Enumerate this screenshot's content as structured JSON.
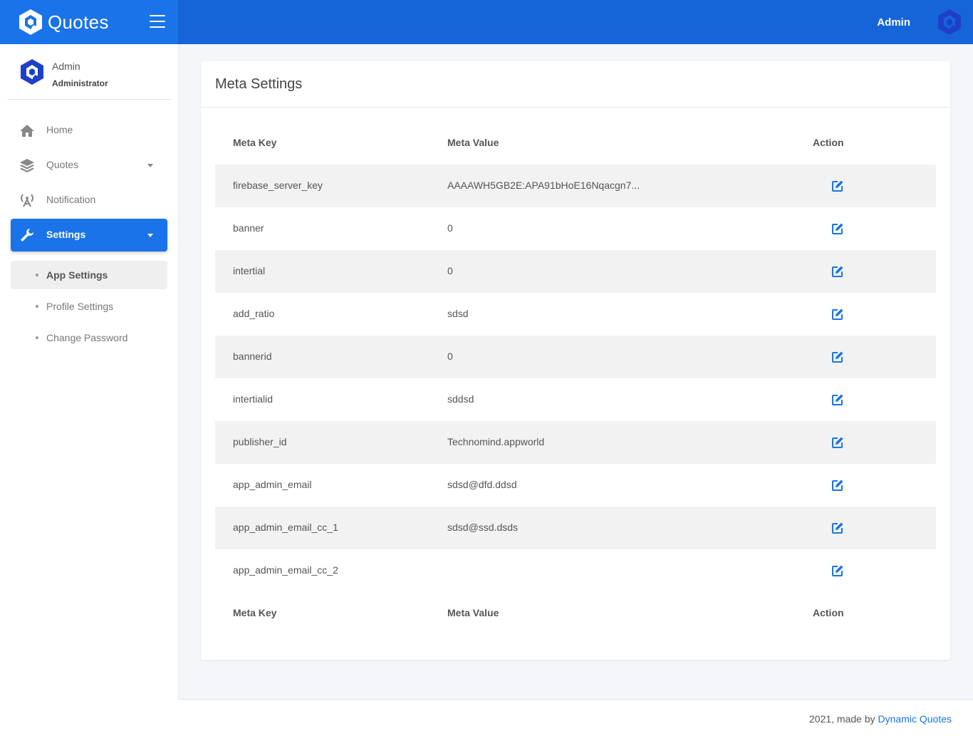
{
  "app": {
    "name": "Quotes",
    "accent": "#1a73e8"
  },
  "header": {
    "user_label": "Admin"
  },
  "user_panel": {
    "name": "Admin",
    "role": "Administrator"
  },
  "sidebar": {
    "items": [
      {
        "label": "Home",
        "icon": "home-icon"
      },
      {
        "label": "Quotes",
        "icon": "layers-icon"
      },
      {
        "label": "Notification",
        "icon": "broadcast-icon"
      },
      {
        "label": "Settings",
        "icon": "wrench-icon"
      }
    ],
    "sub_items": [
      {
        "label": "App Settings"
      },
      {
        "label": "Profile Settings"
      },
      {
        "label": "Change Password"
      }
    ]
  },
  "card": {
    "title": "Meta Settings"
  },
  "table": {
    "columns": [
      "Meta Key",
      "Meta Value",
      "Action"
    ],
    "rows": [
      {
        "key": "firebase_server_key",
        "value": "AAAAWH5GB2E:APA91bHoE16Nqacgn7..."
      },
      {
        "key": "banner",
        "value": "0"
      },
      {
        "key": "intertial",
        "value": "0"
      },
      {
        "key": "add_ratio",
        "value": "sdsd"
      },
      {
        "key": "bannerid",
        "value": "0"
      },
      {
        "key": "intertialid",
        "value": "sddsd"
      },
      {
        "key": "publisher_id",
        "value": "Technomind.appworld"
      },
      {
        "key": "app_admin_email",
        "value": "sdsd@dfd.ddsd"
      },
      {
        "key": "app_admin_email_cc_1",
        "value": "sdsd@ssd.dsds"
      },
      {
        "key": "app_admin_email_cc_2",
        "value": ""
      }
    ]
  },
  "footer": {
    "text": "2021, made by",
    "link": "Dynamic Quotes"
  }
}
